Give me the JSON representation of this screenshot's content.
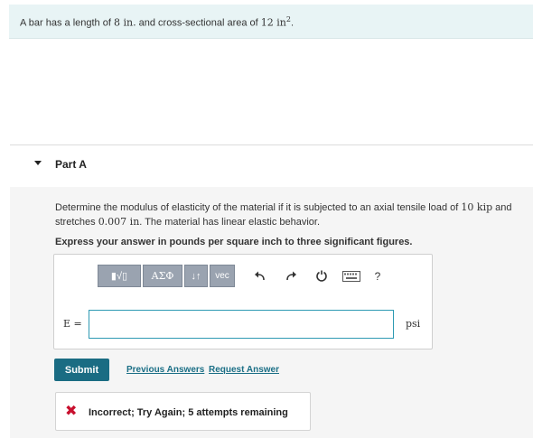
{
  "problem": {
    "prefix": "A bar has a length of ",
    "length": "8 in.",
    "middle": " and cross-sectional area of ",
    "area": "12 in",
    "area_exp": "2",
    "suffix": "."
  },
  "part": {
    "title": "Part A",
    "question_prefix": "Determine the modulus of elasticity of the material if it is subjected to an axial tensile load of ",
    "load": "10 kip",
    "question_middle": " and stretches ",
    "stretch": "0.007 in",
    "question_suffix": ". The material has linear elastic behavior.",
    "instruction": "Express your answer in pounds per square inch to three significant figures."
  },
  "toolbar": {
    "templates_label": "▮√▯",
    "symbols_label": "ΑΣΦ",
    "sort_label": "↓↑",
    "vec_label": "vec",
    "undo_icon": "undo-icon",
    "redo_icon": "redo-icon",
    "reset_icon": "reset-icon",
    "keyboard_icon": "keyboard-icon",
    "help_label": "?"
  },
  "answer": {
    "variable": "E =",
    "value": "",
    "units": "psi"
  },
  "actions": {
    "submit": "Submit",
    "previous_answers": "Previous Answers",
    "request_answer": "Request Answer"
  },
  "feedback": {
    "icon": "✖",
    "message": "Incorrect; Try Again; 5 attempts remaining"
  },
  "colors": {
    "banner_bg": "#e8f4f5",
    "accent": "#1a6c83",
    "error": "#c8102e",
    "input_border": "#2e9ab3"
  }
}
